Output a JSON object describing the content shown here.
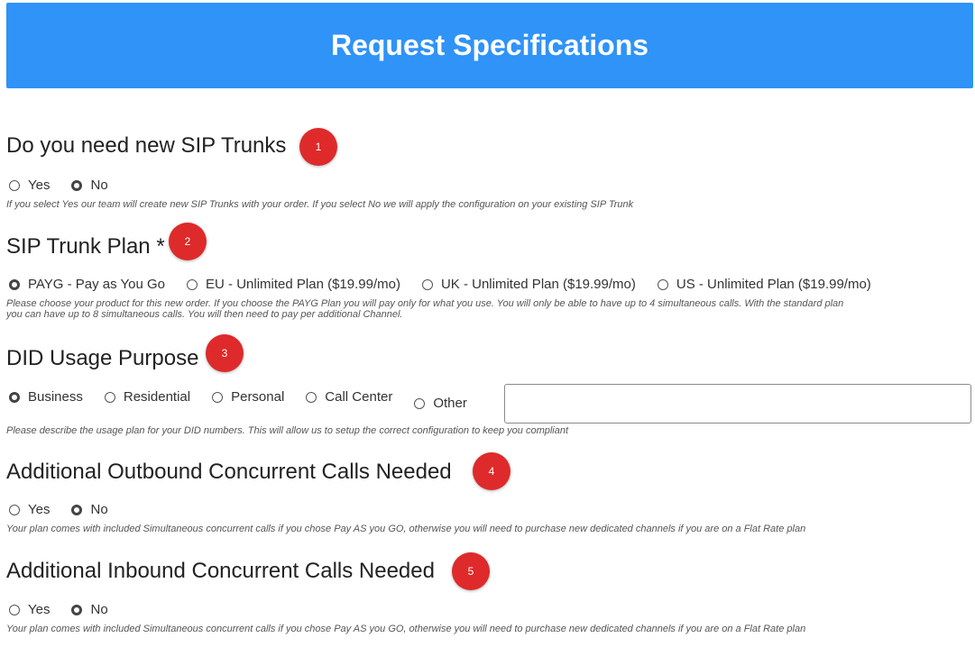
{
  "header": {
    "title": "Request Specifications"
  },
  "q1": {
    "title": "Do you need new SIP Trunks",
    "badge": "1",
    "options": [
      "Yes",
      "No"
    ],
    "selected": "No",
    "help": "If you select Yes our team will create new SIP Trunks with your order. If you select No we will apply the configuration on your existing SIP Trunk"
  },
  "q2": {
    "title": "SIP Trunk Plan *",
    "badge": "2",
    "options": [
      "PAYG - Pay as You Go",
      "EU - Unlimited Plan ($19.99/mo)",
      "UK - Unlimited Plan ($19.99/mo)",
      "US - Unlimited Plan ($19.99/mo)"
    ],
    "selected": "PAYG - Pay as You Go",
    "help_line1": "Please choose your product for this new order. If you choose the PAYG Plan you will pay only for what you use. You will only be able to have up to 4 simultaneous calls. With the standard plan",
    "help_line2": "you can have up to 8 simultaneous calls. You will then need to pay per additional Channel."
  },
  "q3": {
    "title": "DID Usage Purpose",
    "badge": "3",
    "options": [
      "Business",
      "Residential",
      "Personal",
      "Call Center",
      "Other"
    ],
    "selected": "Business",
    "other_value": "",
    "help": "Please describe the usage plan for your DID numbers. This will allow us to setup the correct configuration to keep you compliant"
  },
  "q4": {
    "title": "Additional Outbound Concurrent Calls Needed",
    "badge": "4",
    "options": [
      "Yes",
      "No"
    ],
    "selected": "No",
    "help": "Your plan comes with included Simultaneous concurrent calls if you chose Pay AS you GO, otherwise you will need to purchase new dedicated channels if you are on a Flat Rate plan"
  },
  "q5": {
    "title": "Additional Inbound Concurrent Calls Needed",
    "badge": "5",
    "options": [
      "Yes",
      "No"
    ],
    "selected": "No",
    "help": "Your plan comes with included Simultaneous concurrent calls if you chose Pay AS you GO, otherwise you will need to purchase new dedicated channels if you are on a Flat Rate plan"
  },
  "colors": {
    "header_bg": "#2f93f7",
    "badge_bg": "#de2a2a"
  }
}
